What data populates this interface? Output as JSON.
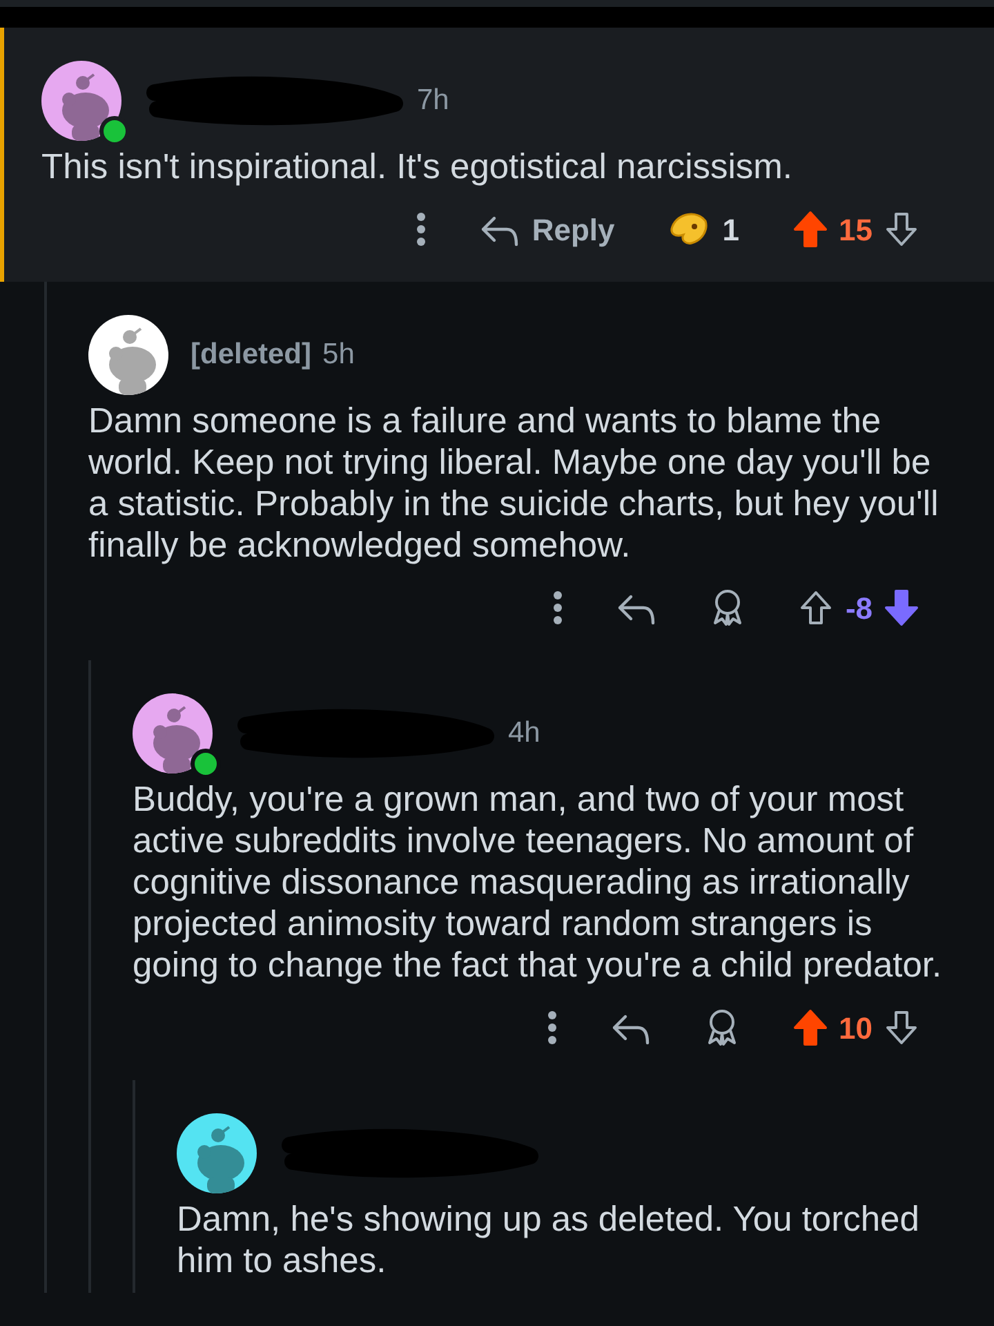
{
  "comments": [
    {
      "color": "#e6a8f0",
      "online": true,
      "redacted": true,
      "time": "7h",
      "highlighted": true,
      "body": "This isn't inspirational. It's egotistical narcissism.",
      "reply_label": "Reply",
      "award_count": "1",
      "upvoted": true,
      "downvoted": false,
      "score": "15",
      "children": [
        {
          "color": "#ffffff",
          "username": "[deleted]",
          "time": "5h",
          "body": "Damn someone is a failure and wants to blame the world. Keep not trying liberal. Maybe one day you'll be a statistic. Probably in the suicide charts, but hey you'll finally be acknowledged somehow.",
          "upvoted": false,
          "downvoted": true,
          "score": "-8",
          "children": [
            {
              "color": "#e6a8f0",
              "online": true,
              "redacted": true,
              "time": "4h",
              "body": "Buddy, you're a grown man, and two of your most active subreddits involve teenagers. No amount of cognitive dissonance masquerading as irrationally projected animosity toward random strangers is going to change the fact that you're a child predator.",
              "upvoted": true,
              "downvoted": false,
              "score": "10",
              "children": [
                {
                  "color": "#54e3f2",
                  "redacted": true,
                  "body": "Damn, he's showing up as deleted. You torched him to ashes."
                }
              ]
            }
          ]
        }
      ]
    }
  ]
}
